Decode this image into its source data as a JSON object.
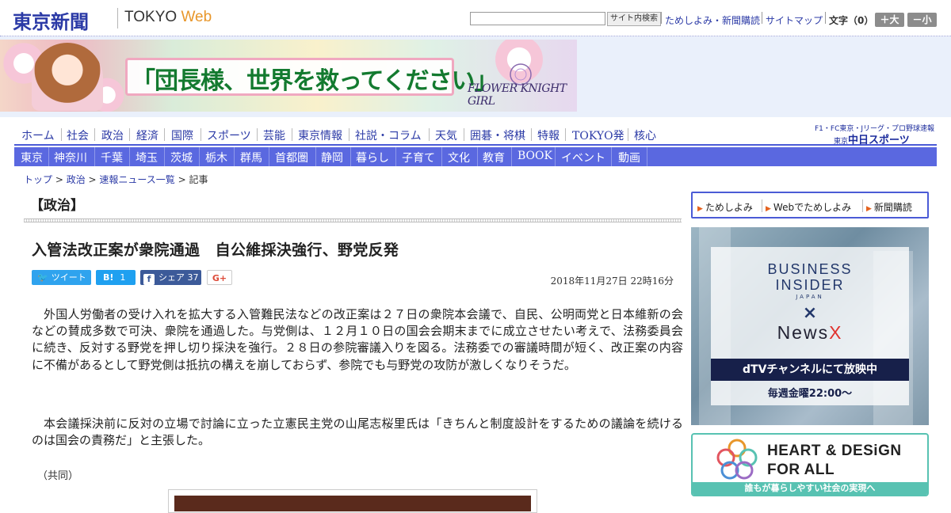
{
  "header": {
    "logo_jp": "東京新聞",
    "logo_en_a": "TOKYO",
    "logo_en_b": "Web",
    "search_button": "サイト内検索",
    "util_links": [
      "ためしよみ・新聞購読",
      "サイトマップ"
    ],
    "font_size_label": "文字（0）",
    "font_up": "＋大",
    "font_down": "－小"
  },
  "banner": {
    "copy": "「団長様、世界を救ってください」",
    "brand": "FLOWER KNIGHT GIRL"
  },
  "nav_primary": [
    "ホーム",
    "社会",
    "政治",
    "経済",
    "国際",
    "スポーツ",
    "芸能",
    "東京情報",
    "社説・コラム",
    "天気",
    "囲碁・将棋",
    "特報",
    "TOKYO発",
    "核心"
  ],
  "sports_logo": {
    "top": "F1・FC東京・Jリーグ・プロ野球速報",
    "small": "東京",
    "main": "中日スポーツ"
  },
  "nav_secondary": [
    "東京",
    "神奈川",
    "千葉",
    "埼玉",
    "茨城",
    "栃木",
    "群馬",
    "首都圏",
    "静岡",
    "暮らし",
    "子育て",
    "文化",
    "教育",
    "BOOK",
    "イベント",
    "動画"
  ],
  "breadcrumb": {
    "items": [
      "トップ",
      "政治",
      "速報ニュース一覧"
    ],
    "current": "記事",
    "sep": " > "
  },
  "article": {
    "section": "【政治】",
    "headline": "入管法改正案が衆院通過　自公維採決強行、野党反発",
    "share": {
      "tweet_label": "ツイート",
      "hatena_label": "B!",
      "hatena_count": "1",
      "fb_label": "シェア",
      "fb_count": "37",
      "gplus_label": "G+"
    },
    "timestamp": "2018年11月27日 22時16分",
    "paragraphs": [
      "外国人労働者の受け入れを拡大する入管難民法などの改正案は２７日の衆院本会議で、自民、公明両党と日本維新の会などの賛成多数で可決、衆院を通過した。与党側は、１２月１０日の国会会期末までに成立させたい考えで、法務委員会に続き、反対する野党を押し切り採決を強行。２８日の参院審議入りを図る。法務委での審議時間が短く、改正案の内容に不備があるとして野党側は抵抗の構えを崩しておらず、参院でも与野党の攻防が激しくなりそうだ。",
      "本会議採決前に反対の立場で討論に立った立憲民主党の山尾志桜里氏は「きちんと制度設計をするための議論を続けるのは国会の責務だ」と主張した。"
    ],
    "credit": "（共同）"
  },
  "sidebar": {
    "subscribe_links": [
      "ためしよみ",
      "Webでためしよみ",
      "新聞購読"
    ],
    "ad1": {
      "line1": "BUSINESS",
      "line2": "INSIDER",
      "line3": "JAPAN",
      "times": "×",
      "newsx_a": "News",
      "newsx_b": "X",
      "band": "dTVチャンネルにて放映中",
      "schedule": "毎週金曜22:00〜"
    },
    "ad2": {
      "line1": "HEART & DESiGN",
      "line2": "FOR ALL",
      "footer": "誰もが暮らしやすい社会の実現へ"
    }
  },
  "colors": {
    "brand_blue": "#2b3aa6",
    "nav_blue": "#5a68e0",
    "accent_orange": "#e8962a",
    "twitter": "#2fa3ee",
    "facebook": "#3c5a99",
    "teal": "#58c2b2"
  }
}
